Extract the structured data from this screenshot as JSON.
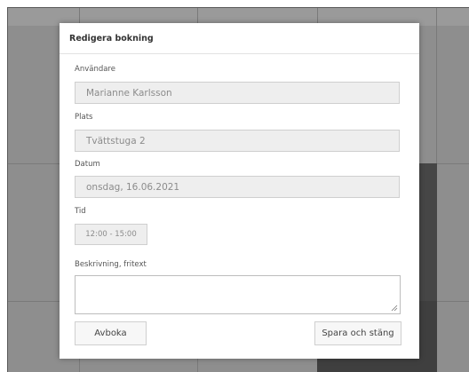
{
  "modal": {
    "title": "Redigera bokning",
    "fields": {
      "user": {
        "label": "Användare",
        "value": "Marianne Karlsson"
      },
      "place": {
        "label": "Plats",
        "value": "Tvättstuga 2"
      },
      "date": {
        "label": "Datum",
        "value": "onsdag, 16.06.2021"
      },
      "time": {
        "label": "Tid",
        "value": "12:00 - 15:00"
      },
      "description": {
        "label": "Beskrivning, fritext",
        "value": ""
      }
    },
    "buttons": {
      "cancel": "Avboka",
      "save": "Spara och stäng"
    }
  },
  "colors": {
    "overlay": "#8e8e8e",
    "modal_bg": "#ffffff",
    "field_bg": "#eeeeee",
    "dark_cell": "#464646"
  }
}
